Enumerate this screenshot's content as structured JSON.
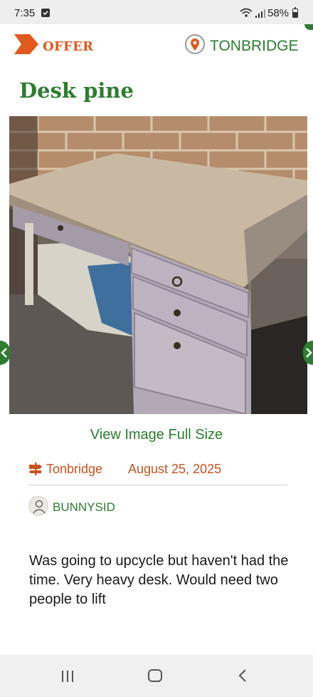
{
  "status_bar": {
    "time": "7:35",
    "battery": "58%"
  },
  "header": {
    "offer_label": "OFFER",
    "location_label": "TONBRIDGE"
  },
  "listing": {
    "title": "Desk pine",
    "view_full_size": "View Image Full Size",
    "location": "Tonbridge",
    "date": "August 25, 2025",
    "username": "BUNNYSID",
    "description": "Was going to upcycle but haven't had the time. Very heavy desk. Would need two people to lift"
  },
  "colors": {
    "brand_green": "#2e7d32",
    "offer_orange": "#e05a1e",
    "meta_orange": "#c8531e"
  },
  "icons": {
    "offer": "offer-arrow-icon",
    "location": "map-pin-icon",
    "signpost": "signpost-icon",
    "avatar": "user-avatar-icon"
  }
}
